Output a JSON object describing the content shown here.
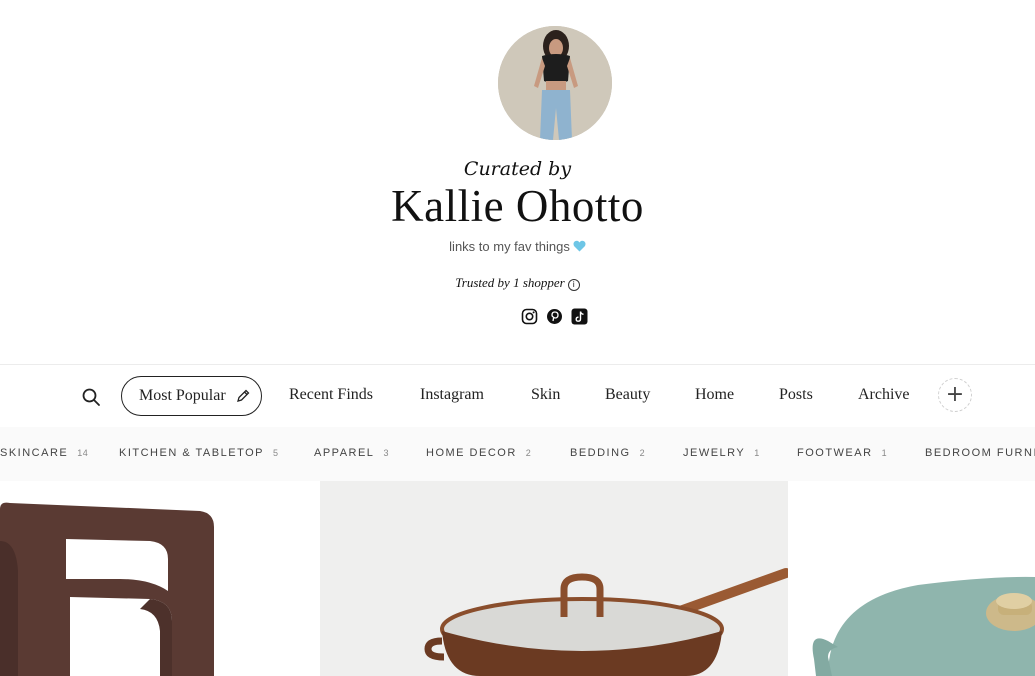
{
  "profile": {
    "curated_label": "Curated by",
    "name": "Kallie Ohotto",
    "bio": "links to my fav things",
    "trusted_text": "Trusted by 1 shopper",
    "socials": [
      "instagram-icon",
      "pinterest-icon",
      "tiktok-icon"
    ]
  },
  "tabs": [
    {
      "label": "Most Popular",
      "active": true
    },
    {
      "label": "Recent Finds"
    },
    {
      "label": "Instagram"
    },
    {
      "label": "Skin"
    },
    {
      "label": "Beauty"
    },
    {
      "label": "Home"
    },
    {
      "label": "Posts"
    },
    {
      "label": "Archive"
    }
  ],
  "add_tab_symbol": "+",
  "categories": [
    {
      "label": "SKINCARE",
      "count": "14"
    },
    {
      "label": "KITCHEN & TABLETOP",
      "count": "5"
    },
    {
      "label": "APPAREL",
      "count": "3"
    },
    {
      "label": "HOME DECOR",
      "count": "2"
    },
    {
      "label": "BEDDING",
      "count": "2"
    },
    {
      "label": "JEWELRY",
      "count": "1"
    },
    {
      "label": "FOOTWEAR",
      "count": "1"
    },
    {
      "label": "BEDROOM FURNITURE",
      "count": ""
    }
  ],
  "products": [
    "brown boucle chair",
    "copper saute pan with glass lid",
    "sage dutch oven"
  ],
  "colors": {
    "heart": "#6ec6e6",
    "chair": "#5a3a33",
    "pan": "#6b3a22",
    "oven": "#8fb5ad"
  }
}
